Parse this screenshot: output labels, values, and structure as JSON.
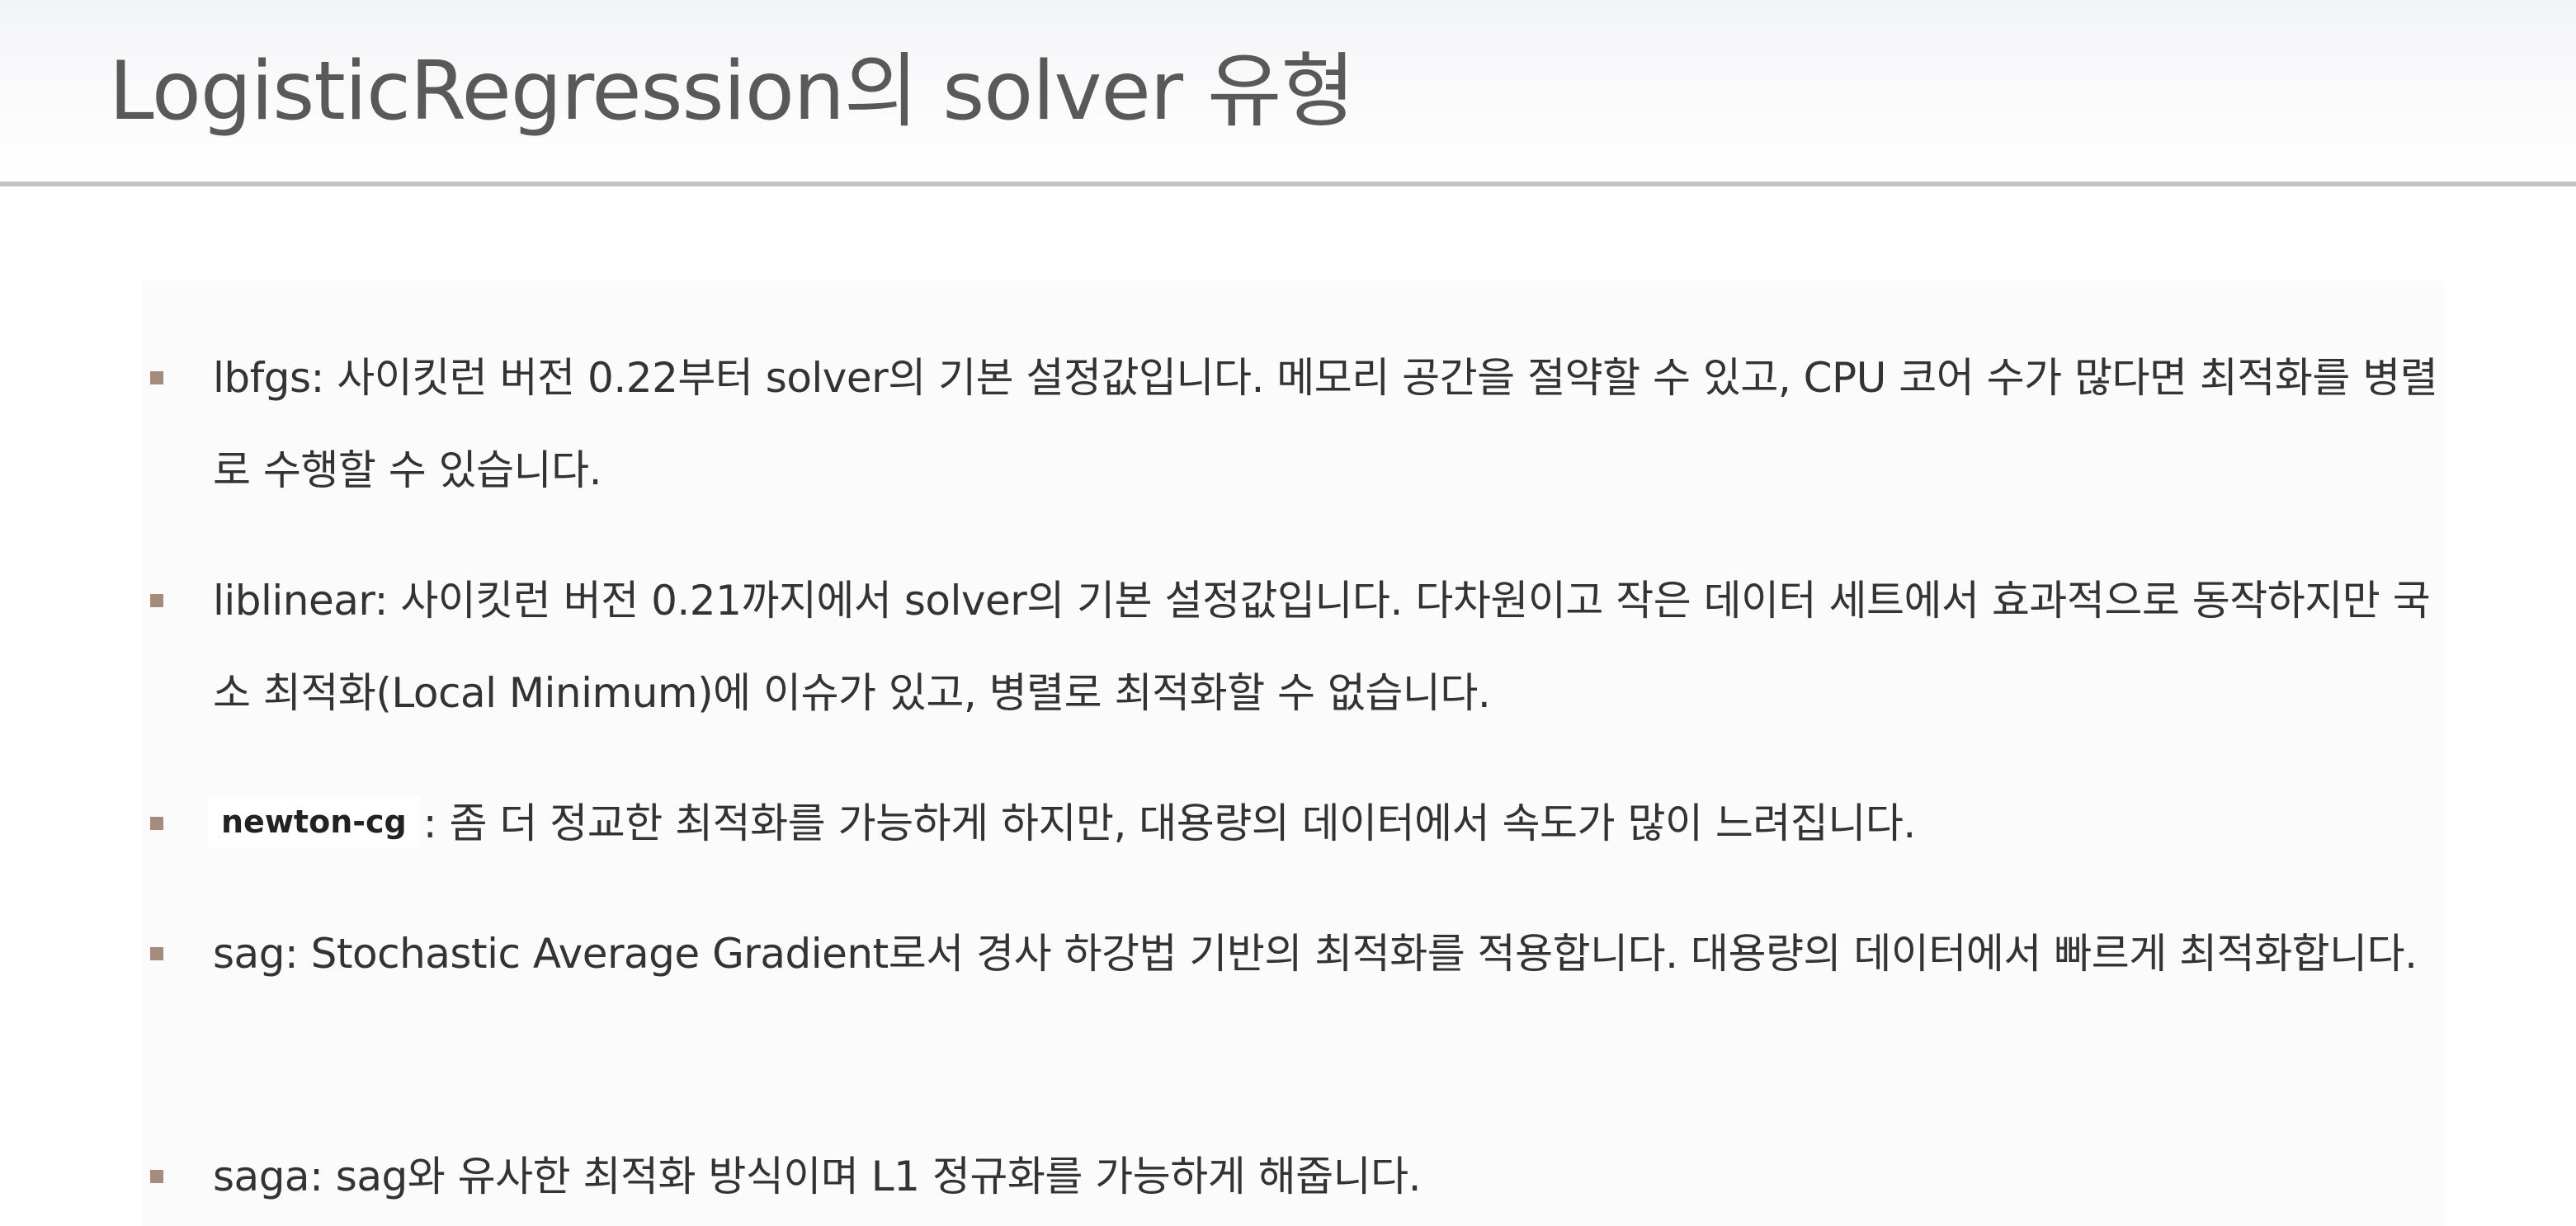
{
  "slide": {
    "title": "LogisticRegression의 solver 유형"
  },
  "bullets": [
    {
      "term": "",
      "text": "lbfgs: 사이킷런 버전 0.22부터 solver의 기본 설정값입니다. 메모리 공간을 절약할 수 있고, CPU 코어 수가 많다면 최적화를 병렬로 수행할 수 있습니다."
    },
    {
      "term": "",
      "text": "liblinear: 사이킷런 버전 0.21까지에서 solver의 기본 설정값입니다. 다차원이고 작은 데이터 세트에서 효과적으로 동작하지만 국소 최적화(Local Minimum)에 이슈가 있고, 병렬로 최적화할 수 없습니다."
    },
    {
      "term": "newton-cg",
      "text": ": 좀 더 정교한 최적화를 가능하게 하지만, 대용량의 데이터에서 속도가 많이 느려집니다."
    },
    {
      "term": "",
      "text": "sag: Stochastic Average Gradient로서 경사 하강법 기반의 최적화를 적용합니다. 대용량의 데이터에서 빠르게 최적화합니다."
    },
    {
      "term": "",
      "text": "saga: sag와 유사한 최적화 방식이며 L1 정규화를 가능하게 해줍니다."
    }
  ],
  "colors": {
    "title_text": "#595959",
    "body_text": "#333333",
    "bullet_marker": "#a58c7a",
    "title_rule": "#c3c3c3"
  }
}
